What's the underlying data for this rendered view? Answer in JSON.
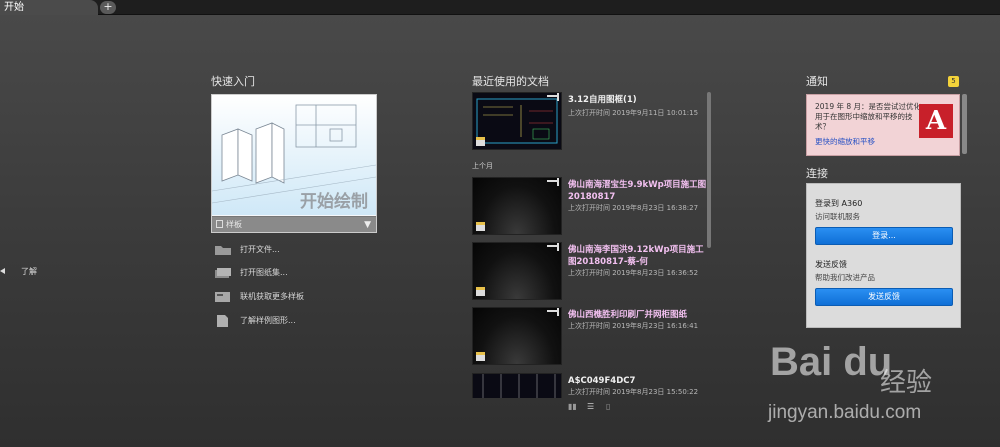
{
  "tabs": {
    "active_label": "开始",
    "add_label": "+"
  },
  "left_panel": {
    "learn_label": "了解"
  },
  "quick_start": {
    "title": "快速入门",
    "card_label": "开始绘制",
    "template_label": "样板",
    "links": [
      {
        "label": "打开文件...",
        "icon": "folder-icon"
      },
      {
        "label": "打开图纸集...",
        "icon": "sheet-set-icon"
      },
      {
        "label": "联机获取更多样板",
        "icon": "online-templates-icon"
      },
      {
        "label": "了解样例图形...",
        "icon": "sample-drawings-icon"
      }
    ]
  },
  "recent": {
    "title": "最近使用的文档",
    "group_label": "上个月",
    "items": [
      {
        "title": "3.12自用图框(1)",
        "time": "上次打开时间 2019年9月11日 10:01:15",
        "thumb": "cad"
      },
      {
        "title": "佛山南海溍宝生9.9kWp项目施工图20180817",
        "time": "上次打开时间 2019年8月23日 16:38:27",
        "thumb": "dark"
      },
      {
        "title": "佛山南海李国洪9.12kWp项目施工图20180817-蔡-何",
        "time": "上次打开时间 2019年8月23日 16:36:52",
        "thumb": "dark"
      },
      {
        "title": "佛山西樵胜利印刷厂并网柜图纸",
        "time": "上次打开时间 2019年8月23日 16:16:41",
        "thumb": "dark"
      },
      {
        "title": "A$C049F4DC7",
        "time": "上次打开时间 2019年8月23日 15:50:22",
        "thumb": "cad"
      }
    ]
  },
  "notifications": {
    "title": "通知",
    "count": "5",
    "text": "2019 年 8 月：是否尝试过优化用于在图形中缩放和平移的技术？",
    "link": "更快的缩放和平移"
  },
  "connect": {
    "title": "连接",
    "a360_heading": "登录到 A360",
    "a360_sub": "访问联机服务",
    "login_button": "登录...",
    "feedback_heading": "发送反馈",
    "feedback_sub": "帮助我们改进产品",
    "feedback_button": "发送反馈"
  },
  "watermark": {
    "logo": "Bai du",
    "cn": "经验",
    "url": "jingyan.baidu.com"
  }
}
